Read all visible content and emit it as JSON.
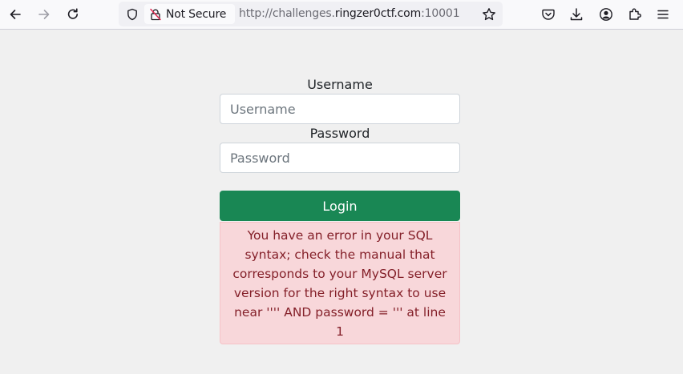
{
  "browser": {
    "security_label": "Not Secure",
    "url_prefix": "http://challenges.",
    "url_host": "ringzer0ctf.com",
    "url_suffix": ":10001",
    "icons": [
      "back-arrow-icon",
      "forward-arrow-icon",
      "reload-icon",
      "tracking-shield-icon",
      "insecure-lock-icon",
      "bookmark-star-icon",
      "pocket-icon",
      "downloads-icon",
      "account-icon",
      "extensions-icon",
      "menu-icon"
    ]
  },
  "form": {
    "username_label": "Username",
    "username_placeholder": "Username",
    "password_label": "Password",
    "password_placeholder": "Password",
    "login_label": "Login"
  },
  "error": {
    "message": "You have an error in your SQL syntax; check the manual that corresponds to your MySQL server version for the right syntax to use near '''' AND password = ''' at line 1"
  },
  "colors": {
    "page_bg": "#f0f0f0",
    "button_green": "#198754",
    "alert_bg": "#f8d7da",
    "alert_text": "#842029"
  }
}
